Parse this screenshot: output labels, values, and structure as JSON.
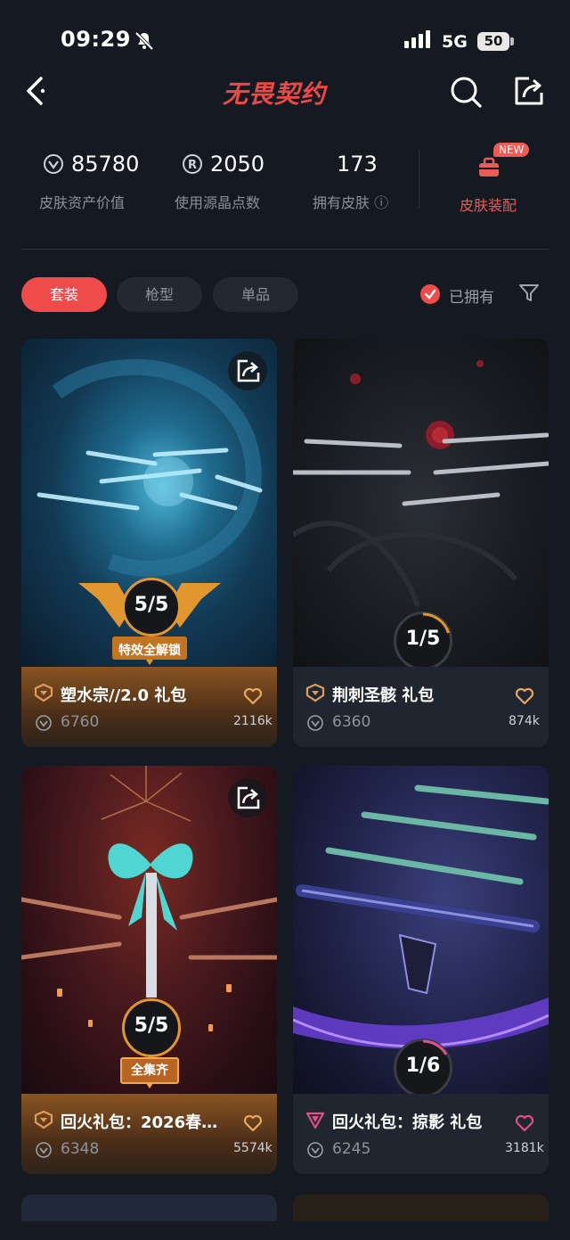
{
  "status": {
    "time": "09:29",
    "network": "5G",
    "battery": "50"
  },
  "header": {
    "logo": "无畏契约"
  },
  "stats": {
    "asset_value": "85780",
    "asset_value_label": "皮肤资产价值",
    "points": "2050",
    "points_label": "使用源晶点数",
    "owned_count": "173",
    "owned_label": "拥有皮肤 ⓘ",
    "new_badge": "NEW",
    "equip_label": "皮肤装配"
  },
  "tabs": [
    {
      "label": "套装",
      "active": true
    },
    {
      "label": "枪型",
      "active": false
    },
    {
      "label": "单品",
      "active": false
    }
  ],
  "owned_filter": "已拥有",
  "cards": [
    {
      "title": "塑水宗//2.0 礼包",
      "price": "6760",
      "likes": "2116k",
      "progress": "5/5",
      "ribbon": "特效全解锁",
      "rank_color": "#e09a5c"
    },
    {
      "title": "荆刺圣骸 礼包",
      "price": "6360",
      "likes": "874k",
      "progress": "1/5",
      "ribbon": "",
      "rank_color": "#e09a5c"
    },
    {
      "title": "回火礼包：2026春…",
      "price": "6348",
      "likes": "5574k",
      "progress": "5/5",
      "ribbon": "全集齐",
      "rank_color": "#e09a5c"
    },
    {
      "title": "回火礼包：掠影 礼包",
      "price": "6245",
      "likes": "3181k",
      "progress": "1/6",
      "ribbon": "",
      "rank_color": "#e0508a"
    }
  ],
  "colors": {
    "accent": "#ef4b4b",
    "bg": "#151a22",
    "gold": "#e2962f"
  }
}
